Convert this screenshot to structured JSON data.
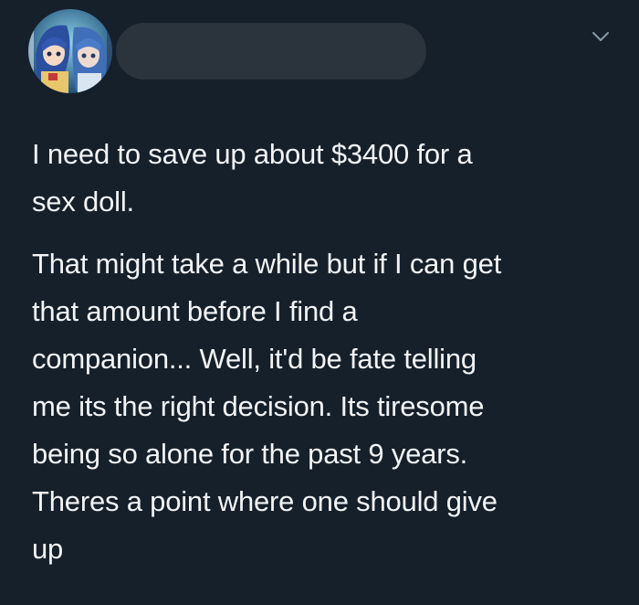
{
  "tweet": {
    "author": {
      "avatar_icon": "anime-character-avatar-icon",
      "name_redacted": true
    },
    "menu_icon": "chevron-down-icon",
    "paragraphs": [
      "I need to save up about $3400 for a\nsex doll.",
      "That might take a while but if I can get\nthat amount before I find a\ncompanion... Well, it'd be fate telling\nme its the right decision. Its tiresome\nbeing so alone for the past 9 years.\nTheres a point where one should give\nup"
    ]
  },
  "colors": {
    "background": "#15202b",
    "text": "#f2f4f6",
    "redaction": "#2b343d",
    "icon": "#8899a6"
  }
}
